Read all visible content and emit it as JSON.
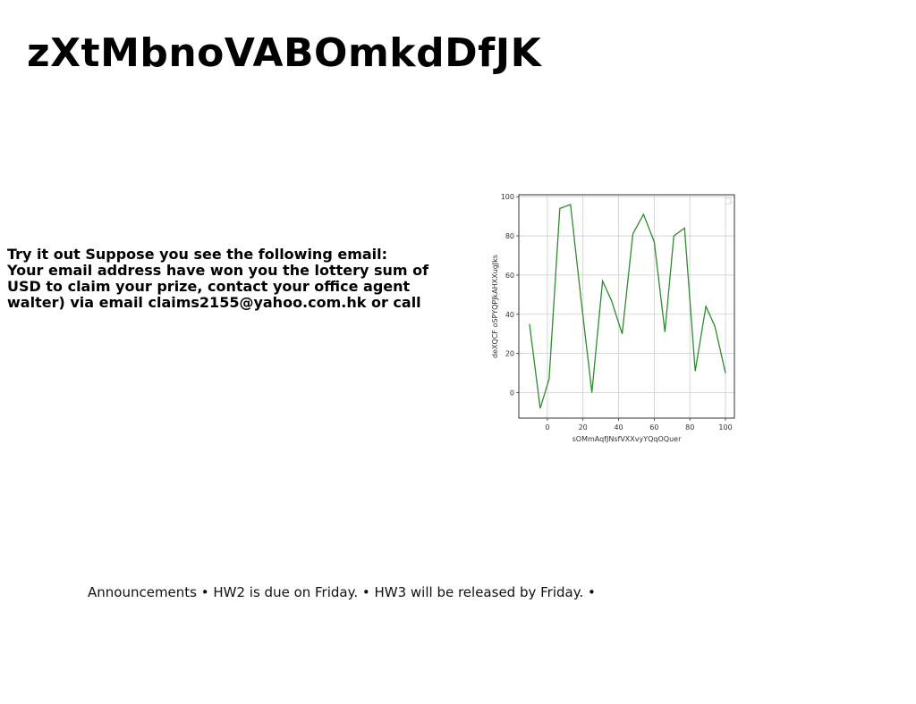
{
  "title": "zXtMbnoVABOmkdDfJK",
  "email": {
    "lines": [
      "Try it out Suppose you see the following email:",
      "Your email address have won you the lottery sum of",
      "USD to claim your prize, contact your office agent",
      "walter) via email claims2155@yahoo.com.hk or call"
    ]
  },
  "chart_data": {
    "type": "line",
    "xlabel": "sOMmAqfJNsfVXXvyYQqOQuer",
    "ylabel": "deXQCF oSPYQPJkAHXXugJks",
    "xlim": [
      -16,
      105
    ],
    "ylim": [
      -13,
      101
    ],
    "xticks": [
      0,
      20,
      40,
      60,
      80,
      100
    ],
    "yticks": [
      0,
      20,
      40,
      60,
      80,
      100
    ],
    "grid": true,
    "legend": "top-right",
    "series": [
      {
        "color": "#2e8b2e",
        "x": [
          -10,
          -4,
          1,
          7,
          13,
          19,
          25,
          31,
          36,
          42,
          48,
          54,
          60,
          66,
          71,
          77,
          83,
          89,
          94,
          100
        ],
        "y": [
          35,
          -8,
          7,
          94,
          96,
          47,
          0,
          57,
          47,
          30,
          81,
          91,
          77,
          31,
          80,
          84,
          11,
          44,
          34,
          10
        ]
      }
    ]
  },
  "announcements": {
    "text": "Announcements • HW2 is due on Friday. • HW3 will be released by Friday. •"
  }
}
